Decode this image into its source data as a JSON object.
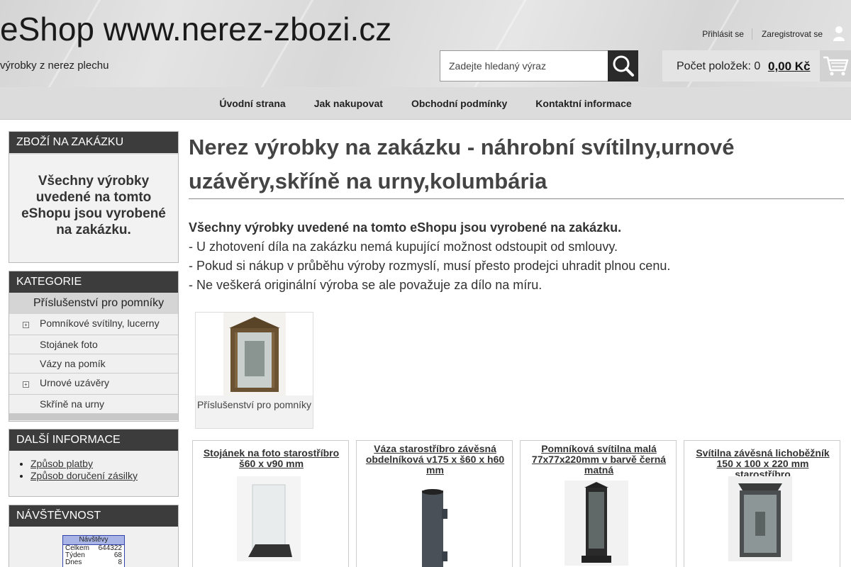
{
  "header": {
    "site_title": "eShop www.nerez-zbozi.cz",
    "site_subtitle": "výrobky z nerez plechu",
    "login": "Přihlásit se",
    "register": "Zaregistrovat se",
    "search_placeholder": "Zadejte hledaný výraz",
    "cart_count_label": "Počet položek: 0",
    "cart_price": "0,00 Kč"
  },
  "nav": {
    "items": [
      "Úvodní strana",
      "Jak nakupovat",
      "Obchodní podmínky",
      "Kontaktní informace"
    ]
  },
  "sidebar": {
    "custom": {
      "heading": "ZBOŽÍ NA ZAKÁZKU",
      "text": "Všechny výrobky uvedené na tomto eShopu jsou vyrobené na zakázku."
    },
    "categories": {
      "heading": "KATEGORIE",
      "parent": "Příslušenství pro pomníky",
      "items": [
        "Pomníkové svítilny, lucerny",
        "Stojánek foto",
        "Vázy na pomík",
        "Urnové uzávěry",
        "Skříně na urny"
      ]
    },
    "info": {
      "heading": "DALŠÍ INFORMACE",
      "links": [
        "Způsob platby",
        "Způsob doručení zásilky"
      ]
    },
    "visits": {
      "heading": "NÁVŠTĚVNOST",
      "counter_title": "Návštěvy",
      "rows": [
        {
          "label": "Celkem",
          "value": "644322"
        },
        {
          "label": "Týden",
          "value": "68"
        },
        {
          "label": "Dnes",
          "value": "8"
        }
      ]
    }
  },
  "main": {
    "title": "Nerez výrobky na zakázku - náhrobní svítilny,urnové uzávěry,skříně na urny,kolumbária",
    "intro_bold": "Všechny výrobky uvedené na tomto eShopu jsou vyrobené na zakázku.",
    "intro_lines": [
      "- U zhotovení díla na zakázku nemá kupující možnost odstoupit od smlouvy.",
      "- Pokud si nákup v průběhu výroby rozmyslí, musí přesto prodejci uhradit plnou cenu.",
      "- Ne veškerá originální výroba se ale považuje za dílo na míru."
    ],
    "subcategory": "Příslušenství pro pomníky",
    "products": [
      "Stojánek na foto starostříbro š60 x v90 mm",
      "Váza starostříbro závěsná obdelníková v175 x š60 x h60 mm",
      "Pomníková svítilna malá 77x77x220mm v barvě černá matná",
      "Svítilna závěsná lichoběžník 150 x 100 x 220 mm starostříbro"
    ]
  }
}
